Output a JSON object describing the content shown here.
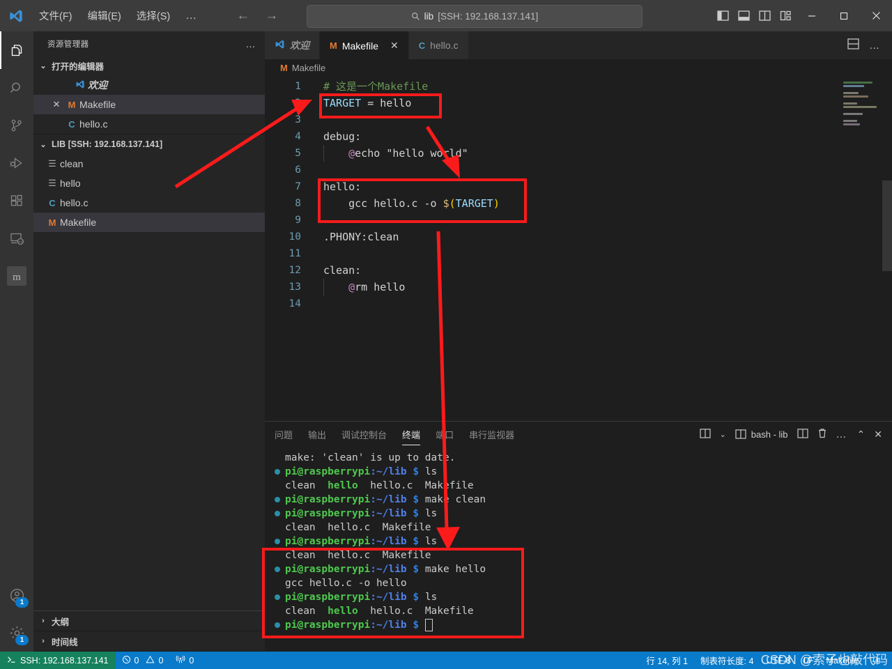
{
  "titlebar": {
    "menus": [
      {
        "label": "文件(F)",
        "key": "F"
      },
      {
        "label": "编辑(E)",
        "key": "E"
      },
      {
        "label": "选择(S)",
        "key": "S"
      }
    ],
    "more_label": "…",
    "back_icon": "arrow-left-icon",
    "forward_icon": "arrow-right-icon",
    "quick_input": {
      "search_icon": "search-icon",
      "title": "lib",
      "host": "[SSH: 192.168.137.141]"
    },
    "layout_toggles": [
      "toggle-primary-sidebar-icon",
      "toggle-panel-icon",
      "toggle-secondary-sidebar-icon",
      "customize-layout-icon"
    ],
    "window_controls": [
      "minimize",
      "maximize",
      "close"
    ]
  },
  "activitybar": {
    "items": [
      {
        "name": "explorer",
        "icon": "files-icon",
        "active": true
      },
      {
        "name": "search",
        "icon": "search-icon",
        "active": false
      },
      {
        "name": "source-control",
        "icon": "source-control-icon",
        "active": false
      },
      {
        "name": "run-debug",
        "icon": "run-debug-icon",
        "active": false
      },
      {
        "name": "extensions",
        "icon": "extensions-icon",
        "active": false
      },
      {
        "name": "remote-explorer",
        "icon": "remote-explorer-icon",
        "active": false
      },
      {
        "name": "platformio",
        "icon": "platformio-icon",
        "active": false
      }
    ],
    "account_badge": "1",
    "settings_badge": "1"
  },
  "sidebar": {
    "title": "资源管理器",
    "more_label": "…",
    "open_editors": {
      "title": "打开的编辑器",
      "items": [
        {
          "label": "欢迎",
          "icon": "vscode-icon",
          "selected": false,
          "closable": false,
          "italic": true
        },
        {
          "label": "Makefile",
          "icon": "makefile-icon",
          "selected": true,
          "closable": true,
          "italic": false
        },
        {
          "label": "hello.c",
          "icon": "c-icon",
          "selected": false,
          "closable": false,
          "italic": false
        }
      ]
    },
    "workspace": {
      "title": "LIB [SSH: 192.168.137.141]",
      "items": [
        {
          "label": "clean",
          "icon": "binary-icon",
          "selected": false
        },
        {
          "label": "hello",
          "icon": "binary-icon",
          "selected": false
        },
        {
          "label": "hello.c",
          "icon": "c-icon",
          "selected": false
        },
        {
          "label": "Makefile",
          "icon": "makefile-icon",
          "selected": true
        }
      ]
    },
    "bottom_sections": [
      {
        "label": "大纲"
      },
      {
        "label": "时间线"
      }
    ]
  },
  "editor": {
    "tabs": [
      {
        "label": "欢迎",
        "icon": "vscode-icon",
        "active": false,
        "closable": false
      },
      {
        "label": "Makefile",
        "icon": "makefile-icon",
        "active": true,
        "closable": true
      },
      {
        "label": "hello.c",
        "icon": "c-icon",
        "active": false,
        "closable": false
      }
    ],
    "toolbar": [
      "split-editor-down-icon",
      "more-actions-icon"
    ],
    "breadcrumb": {
      "icon": "makefile-icon",
      "label": "Makefile"
    },
    "lines": [
      {
        "n": "1",
        "tokens": [
          {
            "t": "# 这是一个Makefile",
            "c": "kw-comment"
          }
        ]
      },
      {
        "n": "2",
        "tokens": [
          {
            "t": "TARGET",
            "c": "kw-var"
          },
          {
            "t": " = ",
            "c": "kw-op"
          },
          {
            "t": "hello",
            "c": "kw-plain"
          }
        ]
      },
      {
        "n": "3",
        "tokens": []
      },
      {
        "n": "4",
        "tokens": [
          {
            "t": "debug:",
            "c": "kw-plain"
          }
        ]
      },
      {
        "n": "5",
        "tokens": [
          {
            "t": "    ",
            "c": "kw-plain"
          },
          {
            "t": "@",
            "c": "kw-at"
          },
          {
            "t": "echo ",
            "c": "kw-plain"
          },
          {
            "t": "\"hello world\"",
            "c": "kw-plain"
          }
        ]
      },
      {
        "n": "6",
        "tokens": []
      },
      {
        "n": "7",
        "tokens": [
          {
            "t": "hello:",
            "c": "kw-plain"
          }
        ]
      },
      {
        "n": "8",
        "tokens": [
          {
            "t": "    gcc hello.c -o ",
            "c": "kw-plain"
          },
          {
            "t": "$",
            "c": "kw-dollar"
          },
          {
            "t": "(",
            "c": "kw-paren"
          },
          {
            "t": "TARGET",
            "c": "kw-var"
          },
          {
            "t": ")",
            "c": "kw-paren"
          }
        ]
      },
      {
        "n": "9",
        "tokens": []
      },
      {
        "n": "10",
        "tokens": [
          {
            "t": ".PHONY:clean",
            "c": "kw-plain"
          }
        ]
      },
      {
        "n": "11",
        "tokens": []
      },
      {
        "n": "12",
        "tokens": [
          {
            "t": "clean:",
            "c": "kw-plain"
          }
        ]
      },
      {
        "n": "13",
        "tokens": [
          {
            "t": "    ",
            "c": "kw-plain"
          },
          {
            "t": "@",
            "c": "kw-at"
          },
          {
            "t": "rm hello",
            "c": "kw-plain"
          }
        ]
      },
      {
        "n": "14",
        "tokens": []
      }
    ]
  },
  "panel": {
    "tabs": [
      {
        "label": "问题",
        "active": false
      },
      {
        "label": "输出",
        "active": false
      },
      {
        "label": "调试控制台",
        "active": false
      },
      {
        "label": "终端",
        "active": true
      },
      {
        "label": "端口",
        "active": false
      },
      {
        "label": "串行监视器",
        "active": false
      }
    ],
    "terminal_tab": "bash - lib",
    "actions": [
      "split-terminal-dropdown-icon",
      "split-terminal-icon",
      "kill-terminal-icon",
      "more-actions-icon",
      "collapse-panel-icon",
      "close-panel-icon"
    ],
    "terminal_lines": [
      {
        "type": "output",
        "text": "make: 'clean' is up to date."
      },
      {
        "type": "prompt",
        "user": "pi@raspberrypi",
        "path": ":~/lib",
        "dollar": " $ ",
        "cmd": "ls"
      },
      {
        "type": "ls",
        "parts": [
          {
            "t": "clean",
            "exec": false
          },
          {
            "t": "hello",
            "exec": true
          },
          {
            "t": "hello.c",
            "exec": false
          },
          {
            "t": "Makefile",
            "exec": false
          }
        ]
      },
      {
        "type": "prompt",
        "user": "pi@raspberrypi",
        "path": ":~/lib",
        "dollar": " $ ",
        "cmd": "make clean"
      },
      {
        "type": "prompt",
        "user": "pi@raspberrypi",
        "path": ":~/lib",
        "dollar": " $ ",
        "cmd": "ls"
      },
      {
        "type": "ls",
        "parts": [
          {
            "t": "clean",
            "exec": false
          },
          {
            "t": "hello.c",
            "exec": false
          },
          {
            "t": "Makefile",
            "exec": false
          }
        ]
      },
      {
        "type": "prompt",
        "user": "pi@raspberrypi",
        "path": ":~/lib",
        "dollar": " $ ",
        "cmd": "ls"
      },
      {
        "type": "ls",
        "parts": [
          {
            "t": "clean",
            "exec": false
          },
          {
            "t": "hello.c",
            "exec": false
          },
          {
            "t": "Makefile",
            "exec": false
          }
        ]
      },
      {
        "type": "prompt",
        "user": "pi@raspberrypi",
        "path": ":~/lib",
        "dollar": " $ ",
        "cmd": "make hello"
      },
      {
        "type": "output",
        "text": "gcc hello.c -o hello"
      },
      {
        "type": "prompt",
        "user": "pi@raspberrypi",
        "path": ":~/lib",
        "dollar": " $ ",
        "cmd": "ls"
      },
      {
        "type": "ls",
        "parts": [
          {
            "t": "clean",
            "exec": false
          },
          {
            "t": "hello",
            "exec": true
          },
          {
            "t": "hello.c",
            "exec": false
          },
          {
            "t": "Makefile",
            "exec": false
          }
        ]
      },
      {
        "type": "cursor",
        "user": "pi@raspberrypi",
        "path": ":~/lib",
        "dollar": " $ "
      }
    ]
  },
  "statusbar": {
    "remote_icon": "remote-ssh-icon",
    "remote_label": "SSH: 192.168.137.141",
    "errors_icon": "error-icon",
    "errors": "0",
    "warnings_icon": "warning-icon",
    "warnings": "0",
    "radio_icon": "radio-tower-icon",
    "radio": "0",
    "cursor_position": "行 14, 列 1",
    "indent": "制表符长度: 4",
    "encoding": "UTF-8",
    "eol": "LF",
    "language": "Makefile",
    "bell_icon": "bell-icon"
  },
  "watermark": "CSDN @索子也敲代码",
  "colors": {
    "accent": "#0a7aca",
    "remote_green": "#16825d",
    "annotation_red": "#fb1b1b",
    "terminal_green": "#4ec94e",
    "terminal_blue": "#4f7fe8"
  }
}
